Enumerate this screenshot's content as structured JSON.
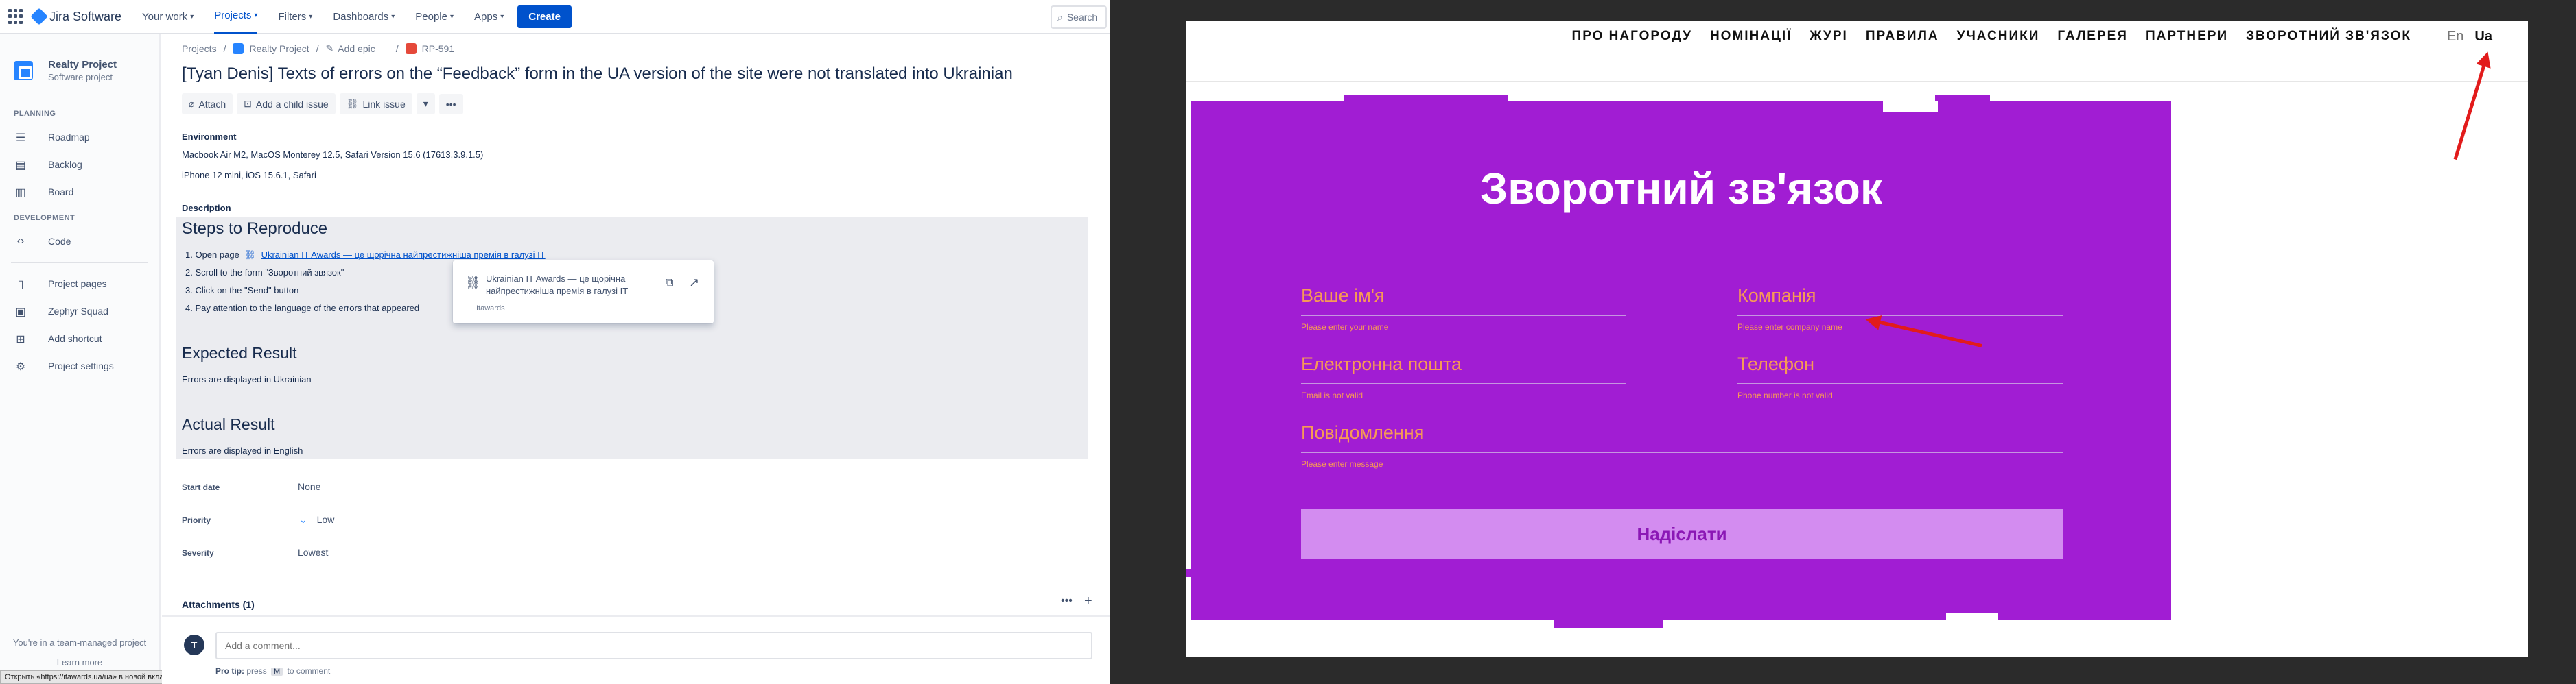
{
  "jira": {
    "topbar": {
      "product": "Jira Software",
      "nav": [
        {
          "label": "Your work",
          "active": false
        },
        {
          "label": "Projects",
          "active": true
        },
        {
          "label": "Filters",
          "active": false
        },
        {
          "label": "Dashboards",
          "active": false
        },
        {
          "label": "People",
          "active": false
        },
        {
          "label": "Apps",
          "active": false
        }
      ],
      "create_label": "Create",
      "search_placeholder": "Search"
    },
    "sidebar": {
      "project_name": "Realty Project",
      "project_type": "Software project",
      "planning_title": "PLANNING",
      "planning_items": [
        {
          "label": "Roadmap",
          "icon": "roadmap-icon"
        },
        {
          "label": "Backlog",
          "icon": "backlog-icon"
        },
        {
          "label": "Board",
          "icon": "board-icon"
        }
      ],
      "development_title": "DEVELOPMENT",
      "development_items": [
        {
          "label": "Code",
          "icon": "code-icon"
        }
      ],
      "other_items": [
        {
          "label": "Project pages",
          "icon": "pages-icon"
        },
        {
          "label": "Zephyr Squad",
          "icon": "zephyr-icon"
        },
        {
          "label": "Add shortcut",
          "icon": "shortcut-icon"
        },
        {
          "label": "Project settings",
          "icon": "settings-icon"
        }
      ],
      "footer_text": "You're in a team-managed project",
      "learn_more": "Learn more",
      "status_link": "Открыть «https://itawards.ua/ua» в новой вкладке"
    },
    "issue": {
      "breadcrumb": {
        "projects": "Projects",
        "project": "Realty Project",
        "add_epic": "Add epic",
        "key": "RP-591"
      },
      "title": "[Tyan Denis] Texts of errors on the “Feedback” form in the UA version of the site were not translated into Ukrainian",
      "actions": {
        "attach": "Attach",
        "add_child": "Add a child issue",
        "link_issue": "Link issue"
      },
      "environment_label": "Environment",
      "environment_lines": [
        "Macbook Air M2, MacOS Monterey 12.5, Safari Version 15.6 (17613.3.9.1.5)",
        "iPhone 12 mini, iOS 15.6.1, Safari"
      ],
      "description_label": "Description",
      "steps_heading": "Steps to Reproduce",
      "steps": {
        "s1_prefix": "1.  Open page",
        "s1_link": "Ukrainian IT Awards — це щорічна найпрестижніша премія в галузі IT",
        "s2": "2.  Scroll to the form \"Зворотний звязок\"",
        "s3": "3.  Click on the \"Send\" button",
        "s4": "4.  Pay attention to the language of the errors that appeared"
      },
      "expected_heading": "Expected Result",
      "expected_text": "Errors are displayed in Ukrainian",
      "actual_heading": "Actual Result",
      "actual_text": "Errors are displayed in English",
      "link_popup": {
        "title": "Ukrainian IT Awards — це щорічна найпрестижніша премія в галузі IT",
        "domain": "Itawards"
      },
      "fields": {
        "start_date_label": "Start date",
        "start_date_value": "None",
        "priority_label": "Priority",
        "priority_value": "Low",
        "severity_label": "Severity",
        "severity_value": "Lowest"
      },
      "attachments_label": "Attachments (1)",
      "comment": {
        "avatar_initial": "T",
        "placeholder": "Add a comment...",
        "pro_tip_prefix": "Pro tip:",
        "pro_tip_press": "press",
        "pro_tip_key": "M",
        "pro_tip_suffix": "to comment"
      }
    }
  },
  "website": {
    "nav": [
      "ПРО НАГОРОДУ",
      "НОМІНАЦІЇ",
      "ЖУРІ",
      "ПРАВИЛА",
      "УЧАСНИКИ",
      "ГАЛЕРЕЯ",
      "ПАРТНЕРИ",
      "ЗВОРОТНИЙ ЗВ'ЯЗОК"
    ],
    "lang_en": "En",
    "lang_ua": "Ua",
    "form_title": "Зворотний зв'язок",
    "fields": [
      {
        "label": "Ваше ім'я",
        "error": "Please enter your name"
      },
      {
        "label": "Компанія",
        "error": "Please enter company name"
      },
      {
        "label": "Електронна пошта",
        "error": "Email is not valid"
      },
      {
        "label": "Телефон",
        "error": "Phone number is not valid"
      },
      {
        "label": "Повідомлення",
        "error": "Please enter message"
      }
    ],
    "submit_label": "Надіслати",
    "colors": {
      "card": "#a11dd3",
      "label": "#f79a55",
      "button": "#d38cf0",
      "annotation_arrow": "#e21b1b"
    }
  }
}
